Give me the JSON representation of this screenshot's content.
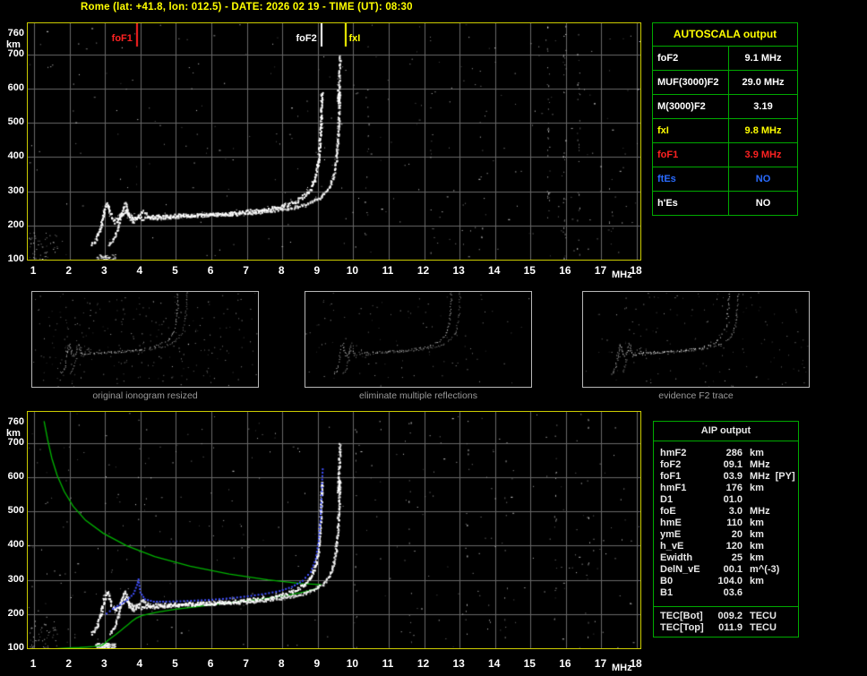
{
  "header": {
    "title": "Rome (lat: +41.8, lon: 012.5) - DATE: 2026 02 19 - TIME (UT): 08:30"
  },
  "colors": {
    "accent_yellow": "#ffff00",
    "plot_border": "#cccc00",
    "panel_green": "#00aa00",
    "grid_gray": "#686868",
    "trace_white": "#ffffff",
    "profile_green": "#00b400",
    "fitted_blue": "#4050ff",
    "foF1_red": "#ff2222",
    "ftEs_blue": "#2a6bff"
  },
  "autoscala": {
    "title": "AUTOSCALA output",
    "rows": [
      {
        "label": "foF2",
        "value": "9.1 MHz",
        "color": "#ffffff"
      },
      {
        "label": "MUF(3000)F2",
        "value": "29.0 MHz",
        "color": "#ffffff"
      },
      {
        "label": "M(3000)F2",
        "value": "3.19",
        "color": "#ffffff"
      },
      {
        "label": "fxI",
        "value": "9.8 MHz",
        "color": "#ffff00"
      },
      {
        "label": "foF1",
        "value": "3.9 MHz",
        "color": "#ff2222"
      },
      {
        "label": "ftEs",
        "value": "NO",
        "color": "#2a6bff"
      },
      {
        "label": "h'Es",
        "value": "NO",
        "color": "#ffffff"
      }
    ]
  },
  "aip": {
    "title": "AIP output",
    "rows": [
      {
        "name": "hmF2",
        "value": "286",
        "unit": "km",
        "note": ""
      },
      {
        "name": "foF2",
        "value": "09.1",
        "unit": "MHz",
        "note": ""
      },
      {
        "name": "foF1",
        "value": "03.9",
        "unit": "MHz",
        "note": "[PY]"
      },
      {
        "name": "hmF1",
        "value": "176",
        "unit": "km",
        "note": ""
      },
      {
        "name": "D1",
        "value": "01.0",
        "unit": "",
        "note": ""
      },
      {
        "name": "foE",
        "value": "3.0",
        "unit": "MHz",
        "note": ""
      },
      {
        "name": "hmE",
        "value": "110",
        "unit": "km",
        "note": ""
      },
      {
        "name": "ymE",
        "value": "20",
        "unit": "km",
        "note": ""
      },
      {
        "name": "h_vE",
        "value": "120",
        "unit": "km",
        "note": ""
      },
      {
        "name": "Ewidth",
        "value": "25",
        "unit": "km",
        "note": ""
      },
      {
        "name": "DelN_vE",
        "value": "00.1",
        "unit": "m^(-3)",
        "note": ""
      },
      {
        "name": "B0",
        "value": "104.0",
        "unit": "km",
        "note": ""
      },
      {
        "name": "B1",
        "value": "03.6",
        "unit": "",
        "note": ""
      }
    ],
    "tec_rows": [
      {
        "name": "TEC[Bot]",
        "value": "009.2",
        "unit": "TECU"
      },
      {
        "name": "TEC[Top]",
        "value": "011.9",
        "unit": "TECU"
      }
    ]
  },
  "thumbnails": [
    {
      "caption": "original ionogram resized"
    },
    {
      "caption": "eliminate multiple reflections"
    },
    {
      "caption": "evidence F2 trace"
    }
  ],
  "chart_data": [
    {
      "id": "top_ionogram",
      "type": "scatter",
      "title": "Recorded ionogram with autoscaled characteristics",
      "xlabel": "MHz",
      "ylabel": "km",
      "xlim": [
        1,
        18
      ],
      "ylim": [
        100,
        760
      ],
      "x_ticks": [
        1,
        2,
        3,
        4,
        5,
        6,
        7,
        8,
        9,
        10,
        11,
        12,
        13,
        14,
        15,
        16,
        17,
        18
      ],
      "y_ticks": [
        760,
        700,
        600,
        500,
        400,
        300,
        200,
        100
      ],
      "grid": true,
      "markers": [
        {
          "label": "foF1",
          "freq": 3.9,
          "color": "#ff2222",
          "side": "left"
        },
        {
          "label": "foF2",
          "freq": 9.1,
          "color": "#ffffff",
          "side": "left"
        },
        {
          "label": "fxI",
          "freq": 9.8,
          "color": "#ffff00",
          "side": "right"
        }
      ],
      "trace_o": [
        [
          2.6,
          145
        ],
        [
          2.7,
          158
        ],
        [
          2.78,
          172
        ],
        [
          2.86,
          196
        ],
        [
          2.93,
          232
        ],
        [
          2.99,
          254
        ],
        [
          3.05,
          266
        ],
        [
          3.11,
          246
        ],
        [
          3.17,
          224
        ],
        [
          3.27,
          212
        ],
        [
          3.37,
          224
        ],
        [
          3.47,
          236
        ],
        [
          3.57,
          242
        ],
        [
          3.67,
          230
        ],
        [
          3.79,
          222
        ],
        [
          3.95,
          221
        ],
        [
          4.2,
          225
        ],
        [
          4.6,
          228
        ],
        [
          5.0,
          230
        ],
        [
          5.4,
          231
        ],
        [
          5.8,
          233
        ],
        [
          6.2,
          235
        ],
        [
          6.6,
          238
        ],
        [
          7.0,
          242
        ],
        [
          7.4,
          247
        ],
        [
          7.8,
          254
        ],
        [
          8.1,
          262
        ],
        [
          8.4,
          274
        ],
        [
          8.62,
          289
        ],
        [
          8.8,
          310
        ],
        [
          8.92,
          342
        ],
        [
          9.0,
          388
        ],
        [
          9.04,
          438
        ],
        [
          9.07,
          492
        ],
        [
          9.09,
          548
        ],
        [
          9.1,
          592
        ]
      ],
      "x_mode_offset": 0.5,
      "trace_x_ext": [
        [
          9.56,
          560
        ],
        [
          9.58,
          612
        ],
        [
          9.6,
          664
        ],
        [
          9.61,
          700
        ]
      ]
    },
    {
      "id": "bottom_ionogram_profile",
      "type": "scatter",
      "title": "Ionogram with fitted trace and electron density profile",
      "xlabel": "MHz",
      "ylabel": "km",
      "xlim": [
        1,
        18
      ],
      "ylim": [
        100,
        760
      ],
      "x_ticks": [
        1,
        2,
        3,
        4,
        5,
        6,
        7,
        8,
        9,
        10,
        11,
        12,
        13,
        14,
        15,
        16,
        17,
        18
      ],
      "y_ticks": [
        760,
        700,
        600,
        500,
        400,
        300,
        200,
        100
      ],
      "grid": true,
      "echo_trace": "same as top_ionogram",
      "fitted_trace": [
        [
          3.02,
          196
        ],
        [
          3.2,
          210
        ],
        [
          3.4,
          222
        ],
        [
          3.6,
          236
        ],
        [
          3.78,
          254
        ],
        [
          3.88,
          280
        ],
        [
          3.92,
          296
        ],
        [
          3.97,
          258
        ],
        [
          4.1,
          238
        ],
        [
          4.35,
          231
        ],
        [
          4.7,
          231
        ],
        [
          5.1,
          232
        ],
        [
          5.5,
          234
        ],
        [
          5.9,
          236
        ],
        [
          6.3,
          239
        ],
        [
          6.7,
          243
        ],
        [
          7.1,
          248
        ],
        [
          7.5,
          254
        ],
        [
          7.9,
          262
        ],
        [
          8.25,
          274
        ],
        [
          8.55,
          292
        ],
        [
          8.78,
          318
        ],
        [
          8.92,
          356
        ],
        [
          9.0,
          408
        ],
        [
          9.05,
          468
        ],
        [
          9.08,
          530
        ],
        [
          9.1,
          588
        ],
        [
          9.12,
          628
        ]
      ],
      "profile": [
        [
          1.28,
          764
        ],
        [
          1.38,
          710
        ],
        [
          1.5,
          655
        ],
        [
          1.65,
          605
        ],
        [
          1.85,
          558
        ],
        [
          2.1,
          515
        ],
        [
          2.45,
          474
        ],
        [
          2.95,
          436
        ],
        [
          3.6,
          400
        ],
        [
          4.4,
          368
        ],
        [
          5.4,
          340
        ],
        [
          6.5,
          317
        ],
        [
          7.6,
          300
        ],
        [
          8.55,
          289
        ],
        [
          9.08,
          286
        ],
        [
          9.0,
          276
        ],
        [
          8.65,
          265
        ],
        [
          8.1,
          254
        ],
        [
          7.35,
          243
        ],
        [
          6.5,
          233
        ],
        [
          5.7,
          223
        ],
        [
          5.0,
          214
        ],
        [
          4.45,
          205
        ],
        [
          4.05,
          196
        ],
        [
          3.88,
          188
        ],
        [
          3.76,
          179
        ],
        [
          3.66,
          170
        ],
        [
          3.54,
          160
        ],
        [
          3.42,
          150
        ],
        [
          3.3,
          140
        ],
        [
          3.18,
          131
        ],
        [
          3.08,
          123
        ],
        [
          3.0,
          115
        ],
        [
          2.92,
          109
        ],
        [
          2.68,
          105
        ],
        [
          2.28,
          102
        ],
        [
          1.85,
          100
        ],
        [
          1.5,
          98
        ]
      ]
    }
  ]
}
